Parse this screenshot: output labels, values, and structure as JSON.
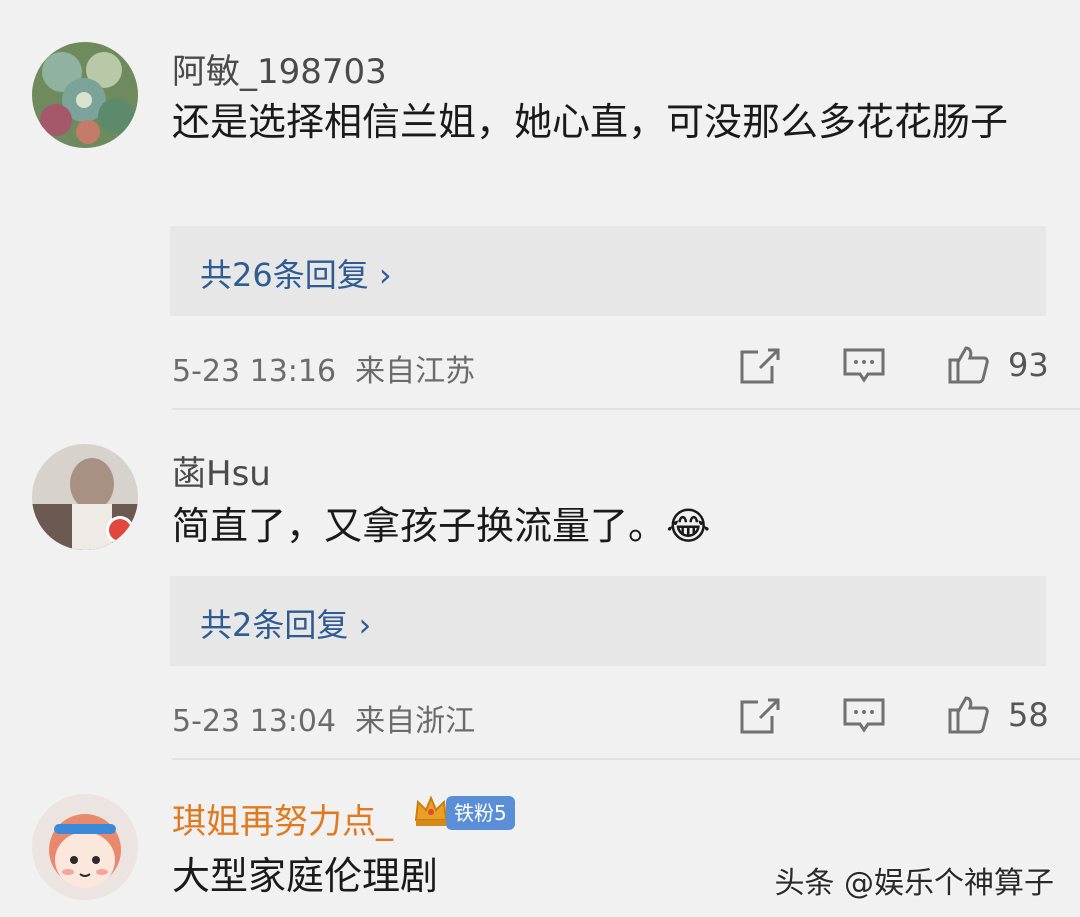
{
  "comments": [
    {
      "username": "阿敏_198703",
      "text": "还是选择相信兰姐，她心直，可没那么多花花肠子",
      "replies_label": "共26条回复",
      "timestamp": "5-23 13:16",
      "location": "来自江苏",
      "likes": "93"
    },
    {
      "username": "菡Hsu",
      "text": "简直了，又拿孩子换流量了。",
      "emoji": "😂",
      "replies_label": "共2条回复",
      "timestamp": "5-23 13:04",
      "location": "来自浙江",
      "likes": "58"
    },
    {
      "username": "琪姐再努力点_",
      "badge": "铁粉5",
      "text": "大型家庭伦理剧"
    }
  ],
  "watermark": "头条 @娱乐个神算子",
  "colors": {
    "link": "#2d5b92",
    "vip_name": "#e07a1f",
    "badge": "#5a8fd8"
  }
}
